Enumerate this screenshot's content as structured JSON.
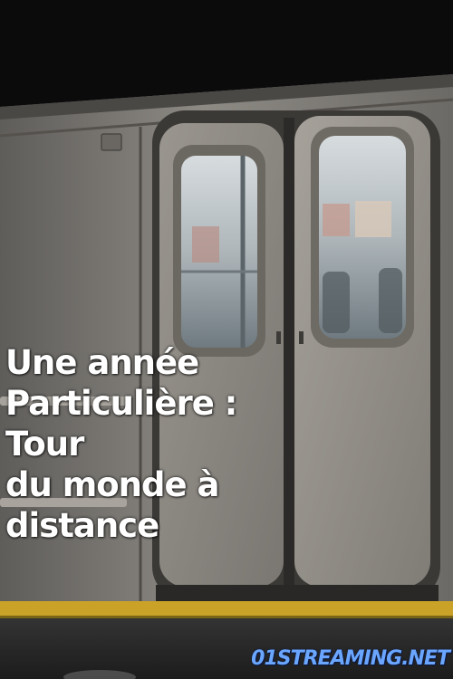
{
  "poster": {
    "title_lines": [
      "Une année",
      "Particulière :",
      "Tour",
      "du monde à",
      "distance"
    ],
    "watermark": "01STREAMING.NET"
  },
  "colors": {
    "background": "#0a0a0b",
    "title_text": "#ffffff",
    "watermark_text": "#6aa6ff",
    "platform_stripe": "#c9a227"
  }
}
